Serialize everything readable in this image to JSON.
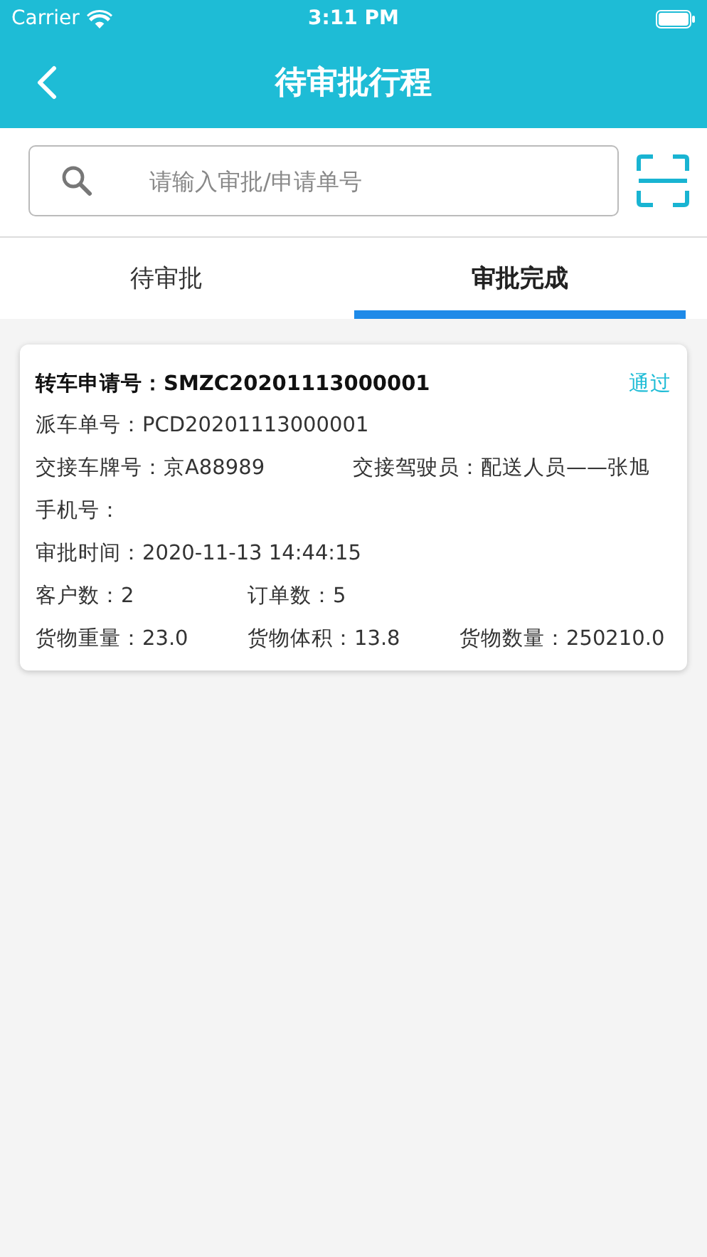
{
  "status_bar": {
    "carrier": "Carrier",
    "time": "3:11 PM"
  },
  "header": {
    "title": "待审批行程"
  },
  "search": {
    "placeholder": "请输入审批/申请单号"
  },
  "tabs": [
    {
      "label": "待审批",
      "selected": false
    },
    {
      "label": "审批完成",
      "selected": true
    }
  ],
  "cards": [
    {
      "title": "转车申请号：SMZC20201113000001",
      "status": "通过",
      "rows": [
        {
          "kind": "single",
          "fields": [
            "派车单号：PCD20201113000001"
          ]
        },
        {
          "kind": "halves",
          "fields": [
            "交接车牌号：京A88989",
            "交接驾驶员：配送人员——张旭"
          ]
        },
        {
          "kind": "single",
          "fields": [
            "手机号："
          ]
        },
        {
          "kind": "single",
          "fields": [
            "审批时间：2020-11-13 14:44:15"
          ]
        },
        {
          "kind": "thirds",
          "fields": [
            "客户数：2",
            "订单数：5"
          ]
        },
        {
          "kind": "thirds",
          "fields": [
            "货物重量：23.0",
            "货物体积：13.8",
            "货物数量：250210.0"
          ]
        }
      ]
    }
  ]
}
